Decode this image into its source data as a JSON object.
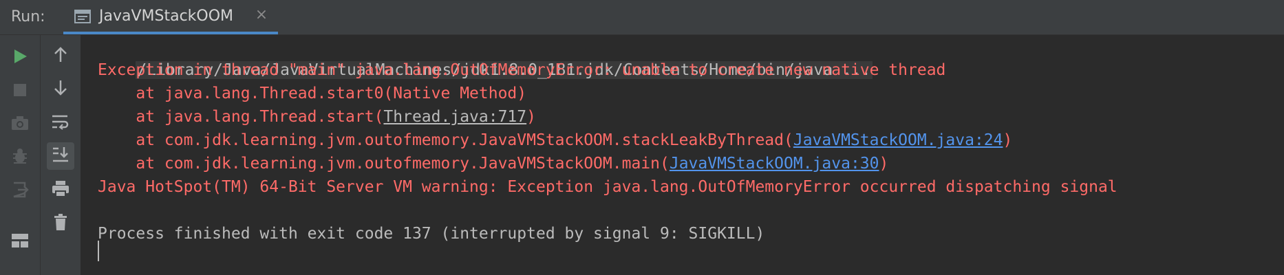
{
  "tabbar": {
    "run_label": "Run:",
    "tab_title": "JavaVMStackOOM",
    "close_glyph": "×"
  },
  "toolbar_left": [
    "run-icon",
    "stop-icon",
    "camera-icon",
    "debug-bug-icon",
    "exit-icon",
    "layout-icon"
  ],
  "toolbar_right": [
    "up-arrow-icon",
    "down-arrow-icon",
    "soft-wrap-icon",
    "scroll-to-end-icon",
    "print-icon",
    "trash-icon"
  ],
  "console": {
    "cmd": "/Library/Java/JavaVirtualMachines/jdk1.8.0_181.jdk/Contents/Home/bin/java ...",
    "exception": "Exception in thread \"main\" java.lang.OutOfMemoryError: unable to create new native thread",
    "st1": "    at java.lang.Thread.start0(Native Method)",
    "st2_pre": "    at java.lang.Thread.start(",
    "st2_link": "Thread.java:717",
    "st2_post": ")",
    "st3_pre": "    at com.jdk.learning.jvm.outofmemory.JavaVMStackOOM.stackLeakByThread(",
    "st3_link": "JavaVMStackOOM.java:24",
    "st3_post": ")",
    "st4_pre": "    at com.jdk.learning.jvm.outofmemory.JavaVMStackOOM.main(",
    "st4_link": "JavaVMStackOOM.java:30",
    "st4_post": ")",
    "warning": "Java HotSpot(TM) 64-Bit Server VM warning: Exception java.lang.OutOfMemoryError occurred dispatching signal",
    "process": "Process finished with exit code 137 (interrupted by signal 9: SIGKILL)"
  },
  "colors": {
    "error": "#ff6b68",
    "normal": "#bbbbbb",
    "link_blue": "#5394ec",
    "run_green": "#59a869",
    "background": "#2b2b2b"
  }
}
